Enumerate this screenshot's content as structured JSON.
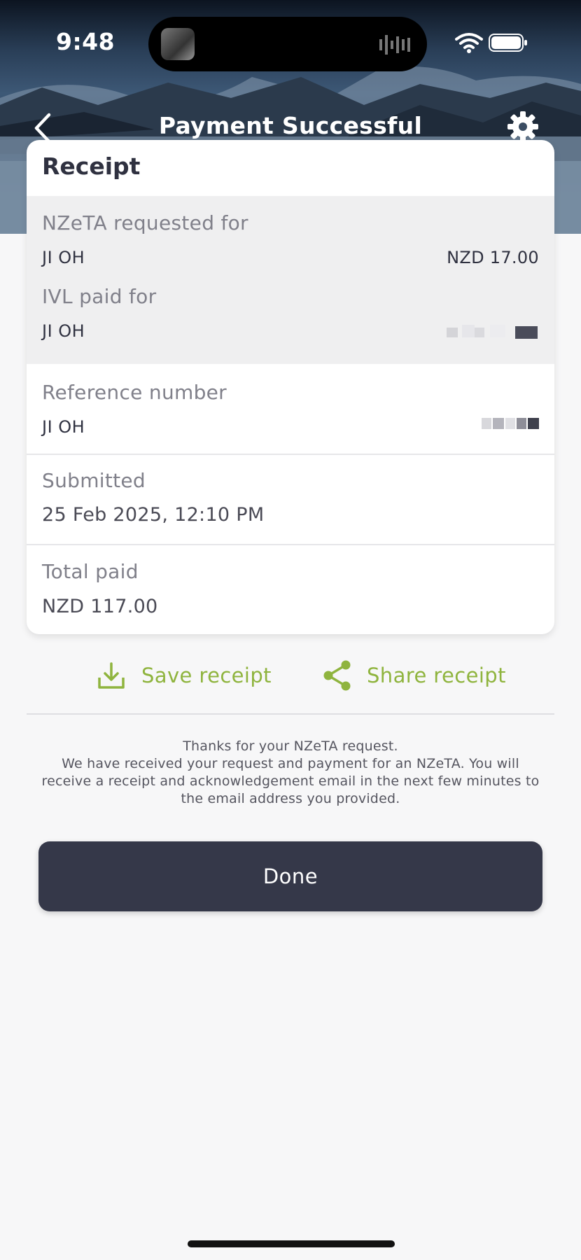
{
  "status_bar": {
    "time": "9:48"
  },
  "nav": {
    "title": "Payment Successful"
  },
  "receipt": {
    "title": "Receipt",
    "nzeta_label": "NZeTA requested for",
    "nzeta_name": "JI OH",
    "nzeta_amount": "NZD 17.00",
    "ivl_label": "IVL paid for",
    "ivl_name": "JI OH",
    "reference_label": "Reference number",
    "reference_name": "JI OH",
    "submitted_label": "Submitted",
    "submitted_value": "25 Feb 2025, 12:10 PM",
    "total_label": "Total paid",
    "total_value": "NZD 117.00"
  },
  "actions": {
    "save_label": "Save receipt",
    "share_label": "Share receipt"
  },
  "message": {
    "line1": "Thanks for your NZeTA request.",
    "line2": "We have received your request and payment for an NZeTA. You will receive a receipt and acknowledgement email in the next few minutes to the email address you provided."
  },
  "done_label": "Done",
  "colors": {
    "accent_green": "#8fb43e",
    "button_dark": "#353849",
    "title_dark": "#2f3140"
  },
  "icons": [
    "wifi-icon",
    "battery-icon",
    "back-chevron-icon",
    "gear-icon",
    "download-icon",
    "share-icon"
  ]
}
